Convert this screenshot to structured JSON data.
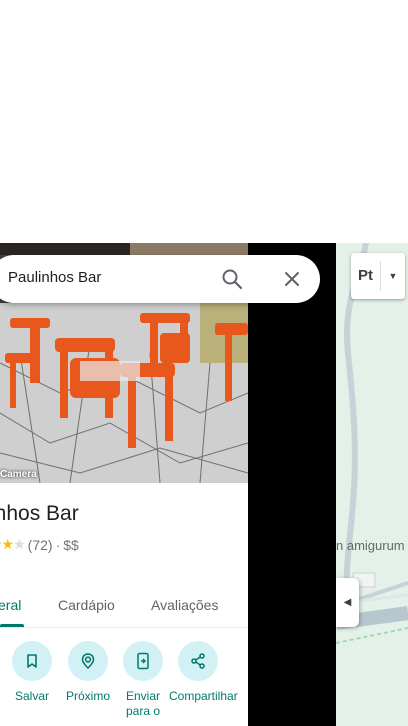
{
  "search": {
    "query": "Paulinhos Bar"
  },
  "place": {
    "photo_caption": "Camera",
    "name": "inhos Bar",
    "rating_count": "(72)",
    "separator": "·",
    "price": "$$"
  },
  "tabs": [
    {
      "label": "eral",
      "active": true
    },
    {
      "label": "Cardápio",
      "active": false
    },
    {
      "label": "Avaliações",
      "active": false
    }
  ],
  "actions": [
    {
      "label": "Salvar",
      "icon": "bookmark-icon"
    },
    {
      "label": "Próximo",
      "icon": "nearby-icon"
    },
    {
      "label": "Enviar para o",
      "icon": "send-to-phone-icon"
    },
    {
      "label": "Compartilhar",
      "icon": "share-icon"
    }
  ],
  "map": {
    "layer_label": "Pt",
    "place_label": "n amigurum"
  },
  "colors": {
    "accent": "#00796b",
    "action_bg": "#d2f1f5",
    "star": "#fbbc04",
    "map_bg": "#e3f1e8"
  }
}
